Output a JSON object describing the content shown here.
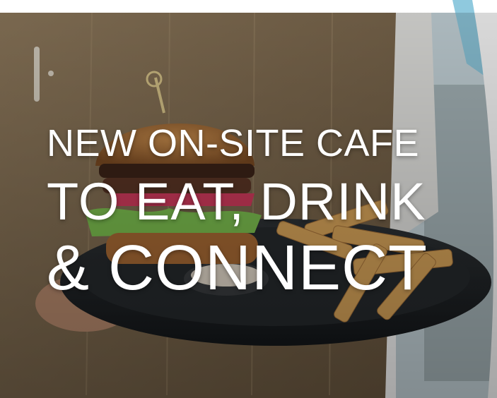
{
  "hero": {
    "line1": "NEW ON-SITE CAFE",
    "line2": "TO EAT, DRINK",
    "line3": "& CONNECT"
  },
  "colors": {
    "text": "#ffffff",
    "apron": "#8a7356",
    "plate": "#1f2225",
    "bun": "#b7743a",
    "fries": "#d9a55a",
    "accent_blue": "#7fc2dc"
  }
}
